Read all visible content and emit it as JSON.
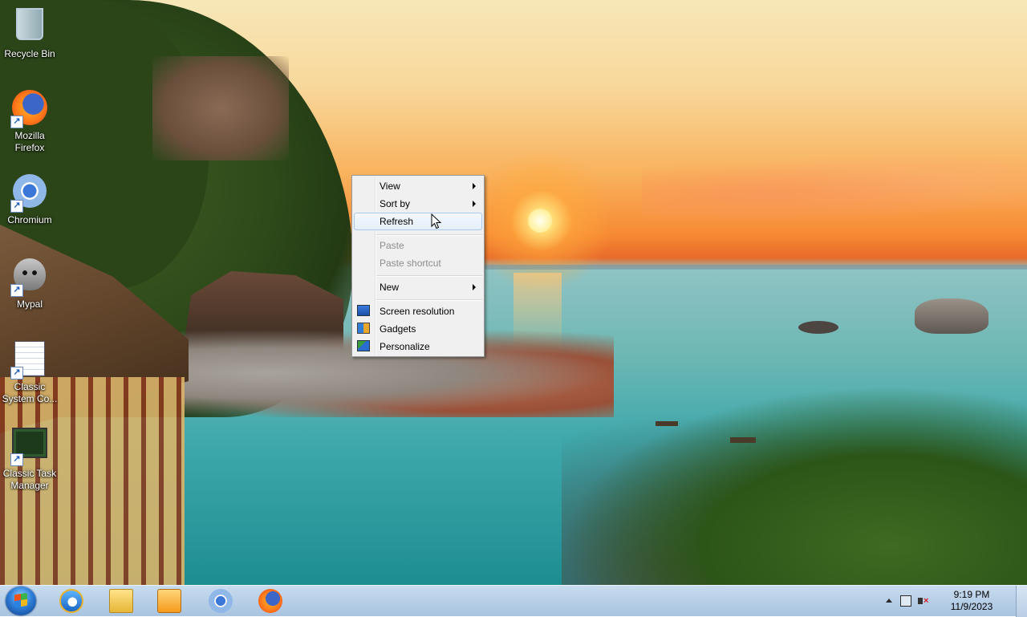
{
  "desktop": {
    "icons": [
      {
        "label": "Recycle Bin",
        "icon": "recycle-bin-icon"
      },
      {
        "label": "Mozilla Firefox",
        "icon": "firefox-icon"
      },
      {
        "label": "Chromium",
        "icon": "chromium-icon"
      },
      {
        "label": "Mypal",
        "icon": "mypal-icon"
      },
      {
        "label": "Classic System Co...",
        "icon": "system-config-icon"
      },
      {
        "label": "Classic Task Manager",
        "icon": "task-manager-icon"
      }
    ]
  },
  "context_menu": {
    "items": [
      {
        "label": "View",
        "submenu": true
      },
      {
        "label": "Sort by",
        "submenu": true
      },
      {
        "label": "Refresh",
        "hovered": true
      },
      {
        "label": "Paste",
        "disabled": true
      },
      {
        "label": "Paste shortcut",
        "disabled": true
      },
      {
        "label": "New",
        "submenu": true
      },
      {
        "label": "Screen resolution",
        "icon": "screen-resolution-icon"
      },
      {
        "label": "Gadgets",
        "icon": "gadgets-icon"
      },
      {
        "label": "Personalize",
        "icon": "personalize-icon"
      }
    ]
  },
  "taskbar": {
    "pinned": [
      {
        "name": "internet-explorer",
        "icon": "internet-explorer-icon"
      },
      {
        "name": "file-explorer",
        "icon": "folder-icon"
      },
      {
        "name": "media-player",
        "icon": "media-player-icon"
      },
      {
        "name": "chromium",
        "icon": "chromium-icon"
      },
      {
        "name": "firefox",
        "icon": "firefox-icon"
      }
    ],
    "clock": {
      "time": "9:19 PM",
      "date": "11/9/2023"
    }
  },
  "colors": {
    "taskbar": "#b7cfe7",
    "menu_background": "#f0f0f0",
    "menu_hover_border": "#a8c8ec",
    "disabled_text": "#8d8d8d"
  }
}
